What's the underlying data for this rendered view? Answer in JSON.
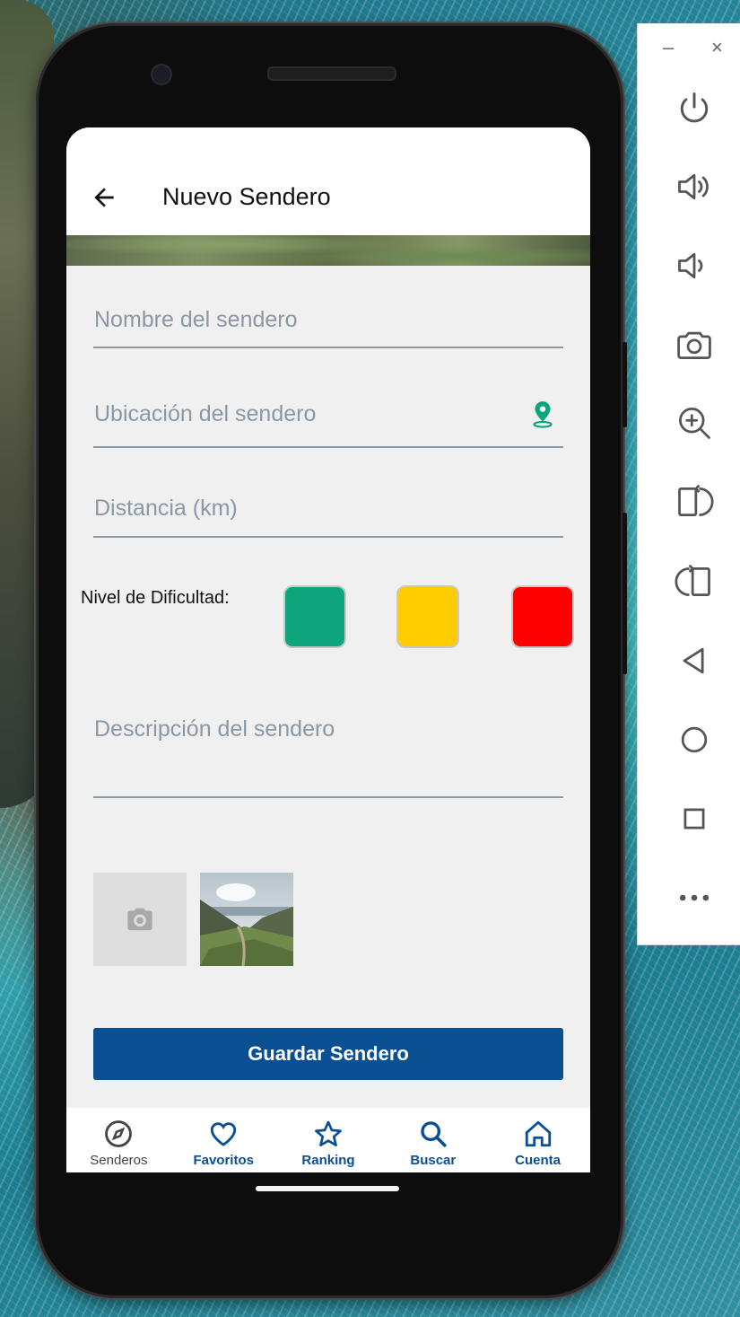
{
  "app": {
    "title": "Nuevo Sendero"
  },
  "form": {
    "name_placeholder": "Nombre del sendero",
    "location_placeholder": "Ubicación del sendero",
    "distance_placeholder": "Distancia (km)",
    "difficulty_label": "Nivel de Dificultad:",
    "description_placeholder": "Descripción del sendero",
    "difficulty_colors": [
      "#0ea57c",
      "#ffcc00",
      "#ff0000"
    ],
    "save_label": "Guardar Sendero"
  },
  "bottom_nav": {
    "items": [
      {
        "label": "Senderos",
        "icon": "compass-icon",
        "color": "#444444"
      },
      {
        "label": "Favoritos",
        "icon": "heart-icon",
        "color": "#0a4f91"
      },
      {
        "label": "Ranking",
        "icon": "star-icon",
        "color": "#0a4f91"
      },
      {
        "label": "Buscar",
        "icon": "search-icon",
        "color": "#0a4f91"
      },
      {
        "label": "Cuenta",
        "icon": "home-icon",
        "color": "#0a4f91"
      }
    ]
  },
  "emulator_panel": {
    "minimize": "–",
    "close": "×",
    "tools": [
      "power-icon",
      "volume-up-icon",
      "volume-down-icon",
      "camera-icon",
      "zoom-icon",
      "rotate-right-icon",
      "rotate-left-icon",
      "back-icon",
      "home-circle-icon",
      "overview-icon",
      "more-icon"
    ]
  },
  "colors": {
    "accent": "#0a4f91",
    "pin": "#0ea57c"
  }
}
